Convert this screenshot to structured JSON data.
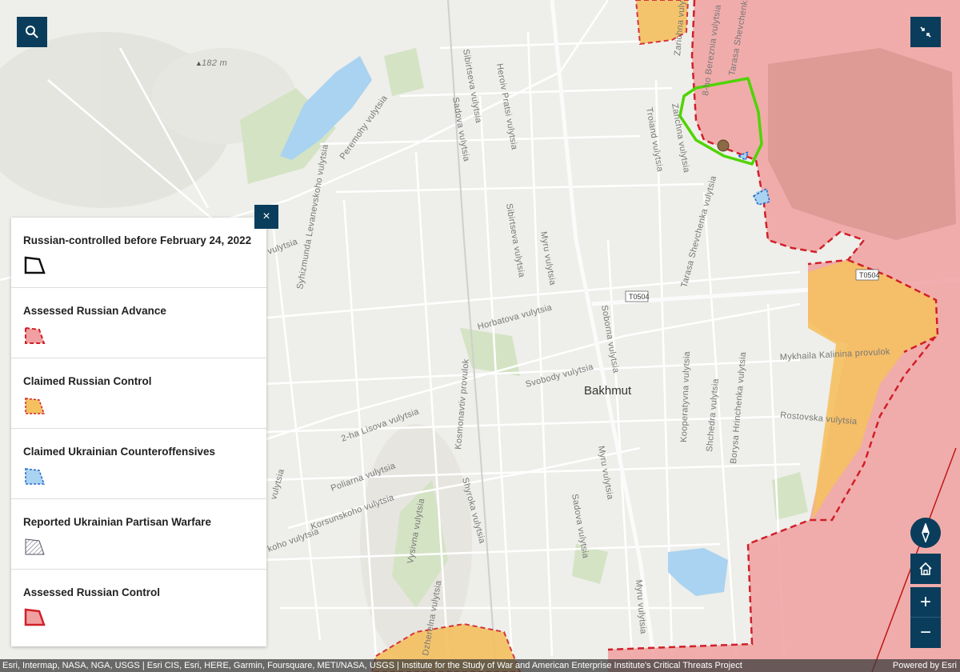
{
  "map": {
    "city": "Bakhmut",
    "elevation": "182 m",
    "road_shield_1": "T0504",
    "road_shield_2": "T0504",
    "streets": {
      "sibirtseva_north": "Sibirtseva vulytsia",
      "heroiv_pratsi": "Heroiv Pratsi vulytsia",
      "sadova_north": "Sadova vulytsia",
      "peremohy": "Peremohy vulytsia",
      "levanevskoho": "Syhizmunda Levanevskoho vulytsia",
      "sibirtseva_mid": "Sibirtseva vulytsia",
      "myru_north": "Myru vulytsia",
      "horbatova": "Horbatova vulytsia",
      "soborna": "Soborna vulytsia",
      "svobody": "Svobody vulytsia",
      "kosmonavtiv": "Kosmonavtiv provulok",
      "lisova": "2-ha Lisova vulytsia",
      "poliarna": "Poliarna vulytsia",
      "korsunskoho": "Korsunskoho vulytsia",
      "shyroka": "Shyroka vulytsia",
      "myru_south": "Myru vulytsia",
      "sadova_south": "Sadova vulytsia",
      "vysivna": "Vysivna vulytsia",
      "dzherelna": "Dzherelna vulytsia",
      "myru_far_south": "Myru vulytsia",
      "zarichna_1": "Zarichna vulytsia",
      "zarichna_2": "Zarichna vulytsia",
      "troiand": "Troiand vulytsia",
      "berezhnia": "8-ho Bereznia vulytsia",
      "shevchenka_north": "Tarasa Shevchenka vulytsia",
      "shevchenka_mid": "Tarasa Shevchenka vulytsia",
      "kooperatyvna": "Kooperatyvna vulytsia",
      "shchedra": "Shchedra vulytsia",
      "hrinchenka": "Borysa Hrinchenka vulytsia",
      "mykhaila": "Mykhaila Kalinina provulok",
      "rostovska": "Rostovska vulytsia",
      "unknown_left_1": "vulytsia",
      "unknown_left_2": "vulytsia",
      "unknown_left_3": "koho vulytsia"
    }
  },
  "legend": {
    "items": [
      {
        "label": "Russian-controlled before February 24, 2022"
      },
      {
        "label": "Assessed Russian Advance"
      },
      {
        "label": "Claimed Russian Control"
      },
      {
        "label": "Claimed Ukrainian Counteroffensives"
      },
      {
        "label": "Reported Ukrainian Partisan Warfare"
      },
      {
        "label": "Assessed Russian Control"
      }
    ],
    "close_symbol": "×"
  },
  "controls": {
    "search_icon": "search-icon",
    "expand_icon": "collapse-arrows-icon",
    "compass_icon": "compass-icon",
    "home_icon": "home-icon",
    "zoom_in": "+",
    "zoom_out": "−"
  },
  "attribution": {
    "sources": "Esri, Intermap, NASA, NGA, USGS | Esri CIS, Esri, HERE, Garmin, Foursquare, METI/NASA, USGS | Institute for the Study of War and American Enterprise Institute's Critical Threats Project",
    "powered_by": "Powered by Esri"
  },
  "colors": {
    "russian_control_fill": "#f0a0a0",
    "russian_control_border": "#d0202a",
    "claimed_control_fill": "#f5c060",
    "highlight_circle": "#4fd400",
    "water": "#a9d3f0",
    "ui_dark": "#0a3d5c"
  }
}
